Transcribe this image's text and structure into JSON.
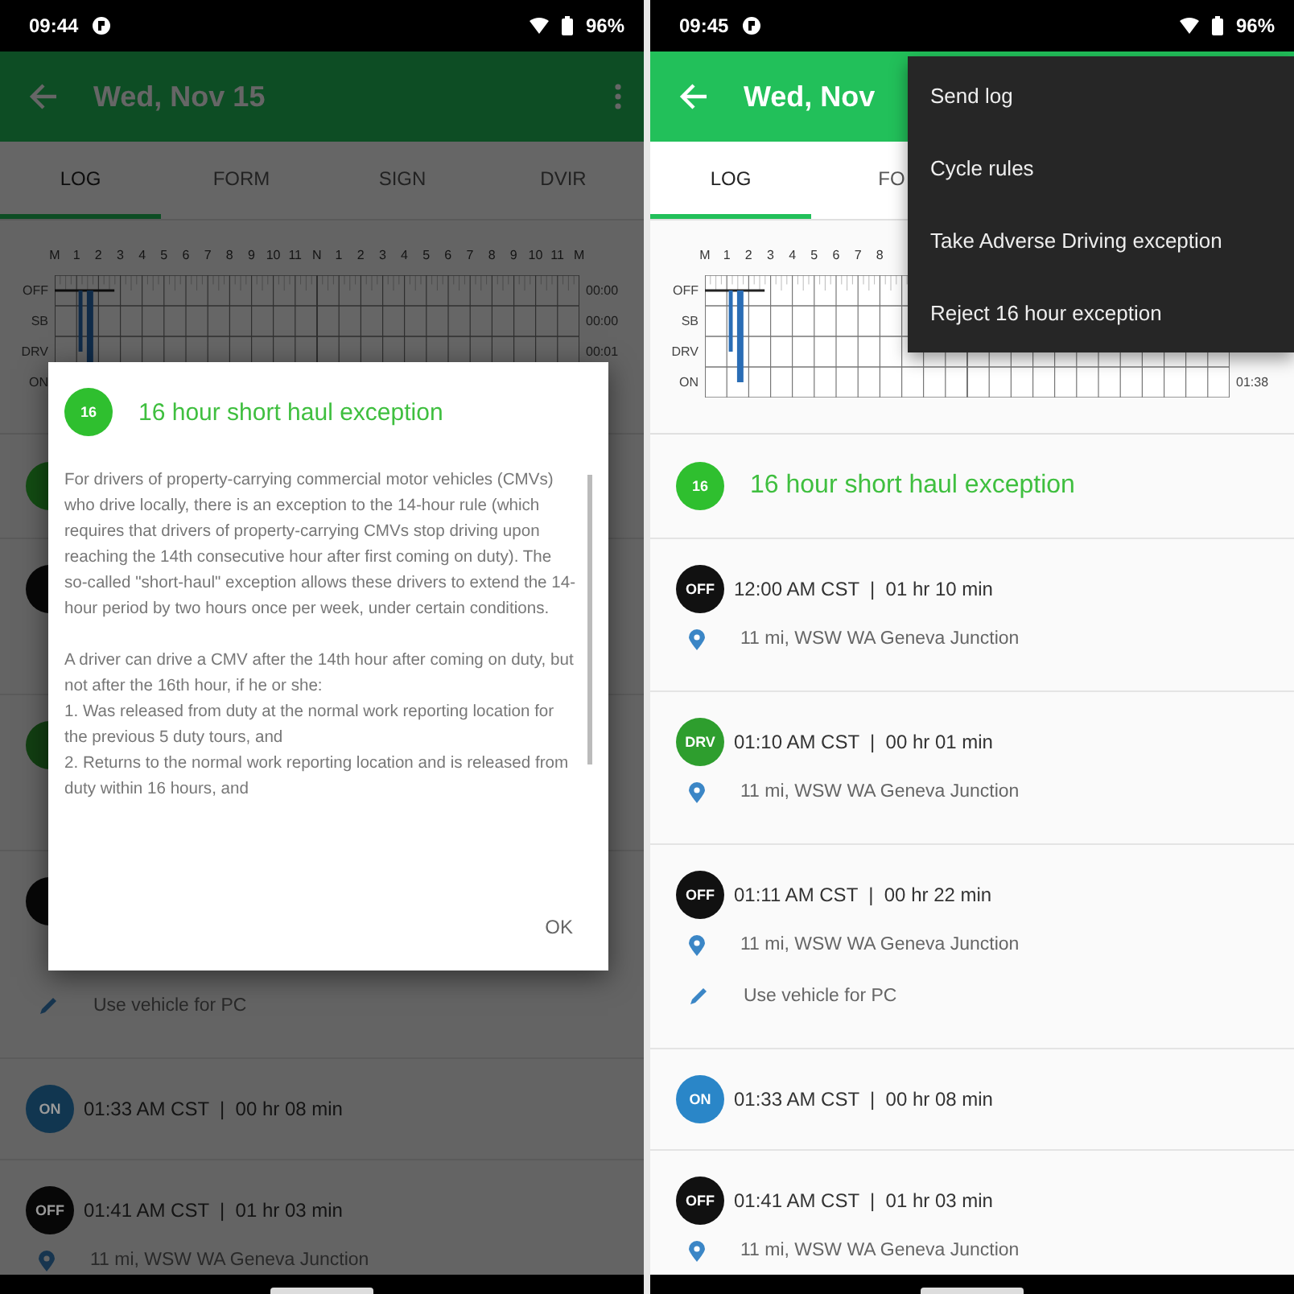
{
  "phones": [
    {
      "status_bar": {
        "time": "09:44",
        "battery": "96%"
      },
      "app_bar": {
        "title": "Wed, Nov 15"
      },
      "tabs": [
        {
          "label": "LOG",
          "selected": true
        },
        {
          "label": "FORM",
          "selected": false
        },
        {
          "label": "SIGN",
          "selected": false
        },
        {
          "label": "DVIR",
          "selected": false
        }
      ],
      "log_grid": {
        "hours": [
          "M",
          "1",
          "2",
          "3",
          "4",
          "5",
          "6",
          "7",
          "8",
          "9",
          "10",
          "11",
          "N",
          "1",
          "2",
          "3",
          "4",
          "5",
          "6",
          "7",
          "8",
          "9",
          "10",
          "11",
          "M"
        ],
        "rows": [
          {
            "label": "OFF",
            "total": "00:00"
          },
          {
            "label": "SB",
            "total": "00:00"
          },
          {
            "label": "DRV",
            "total": "00:01"
          },
          {
            "label": "ON"
          }
        ]
      },
      "list": [
        {
          "kind": "exception",
          "color": "#134c13"
        },
        {
          "kind": "entry",
          "color": "#070707"
        },
        {
          "kind": "entry",
          "color": "#123f12"
        },
        {
          "kind": "entry",
          "color": "#070707",
          "note": "Use vehicle for PC"
        },
        {
          "kind": "entry",
          "color": "#113650",
          "badge": "ON",
          "time": "01:33 AM CST  |  00 hr 08 min"
        },
        {
          "kind": "entry",
          "color": "#070707",
          "badge": "OFF",
          "time": "01:41 AM CST  |  01 hr 03 min",
          "location": "11 mi, WSW WA Geneva Junction"
        }
      ],
      "dialog": {
        "badge": "16",
        "title": "16 hour short haul exception",
        "paragraphs": [
          "For drivers of property-carrying commercial motor vehicles (CMVs) who drive locally, there is an exception to the 14-hour rule (which requires that drivers of property-carrying CMVs stop driving upon reaching the 14th consecutive hour after first coming on duty). The so-called \"short-haul\" exception allows these drivers to extend the 14-hour period by two hours once per week, under certain conditions.",
          "A driver can drive a CMV after the 14th hour after coming on duty, but not after the 16th hour, if he or she:",
          "1. Was released from duty at the normal work reporting location for the previous 5 duty tours, and",
          "2. Returns to the normal work reporting location and is released from duty within 16 hours, and"
        ],
        "button": "OK"
      }
    },
    {
      "status_bar": {
        "time": "09:45",
        "battery": "96%"
      },
      "app_bar": {
        "title": "Wed, Nov"
      },
      "tabs": [
        {
          "label": "LOG",
          "selected": true
        },
        {
          "label": "FO",
          "selected": false
        }
      ],
      "log_grid": {
        "hours": [
          "M",
          "1",
          "2",
          "3",
          "4",
          "5",
          "6",
          "7",
          "8"
        ],
        "rows": [
          {
            "label": "OFF"
          },
          {
            "label": "SB"
          },
          {
            "label": "DRV"
          },
          {
            "label": "ON",
            "total": "01:38"
          }
        ]
      },
      "list": [
        {
          "kind": "exception",
          "color": "#2fbf2f",
          "badge": "16",
          "title": "16 hour short haul exception"
        },
        {
          "kind": "entry",
          "color": "#111111",
          "badge": "OFF",
          "time": "12:00 AM CST  |  01 hr 10 min",
          "location": "11 mi, WSW WA Geneva Junction"
        },
        {
          "kind": "entry",
          "color": "#2e9e2e",
          "badge": "DRV",
          "time": "01:10 AM CST  |  00 hr 01 min",
          "location": "11 mi, WSW WA Geneva Junction"
        },
        {
          "kind": "entry",
          "color": "#111111",
          "badge": "OFF",
          "time": "01:11 AM CST  |  00 hr 22 min",
          "location": "11 mi, WSW WA Geneva Junction",
          "note": "Use vehicle for PC"
        },
        {
          "kind": "entry",
          "color": "#2a86c8",
          "badge": "ON",
          "time": "01:33 AM CST  |  00 hr 08 min"
        },
        {
          "kind": "entry",
          "color": "#111111",
          "badge": "OFF",
          "time": "01:41 AM CST  |  01 hr 03 min",
          "location": "11 mi, WSW WA Geneva Junction"
        }
      ],
      "menu": [
        "Send log",
        "Cycle rules",
        "Take Adverse Driving exception",
        "Reject 16 hour exception"
      ]
    }
  ]
}
